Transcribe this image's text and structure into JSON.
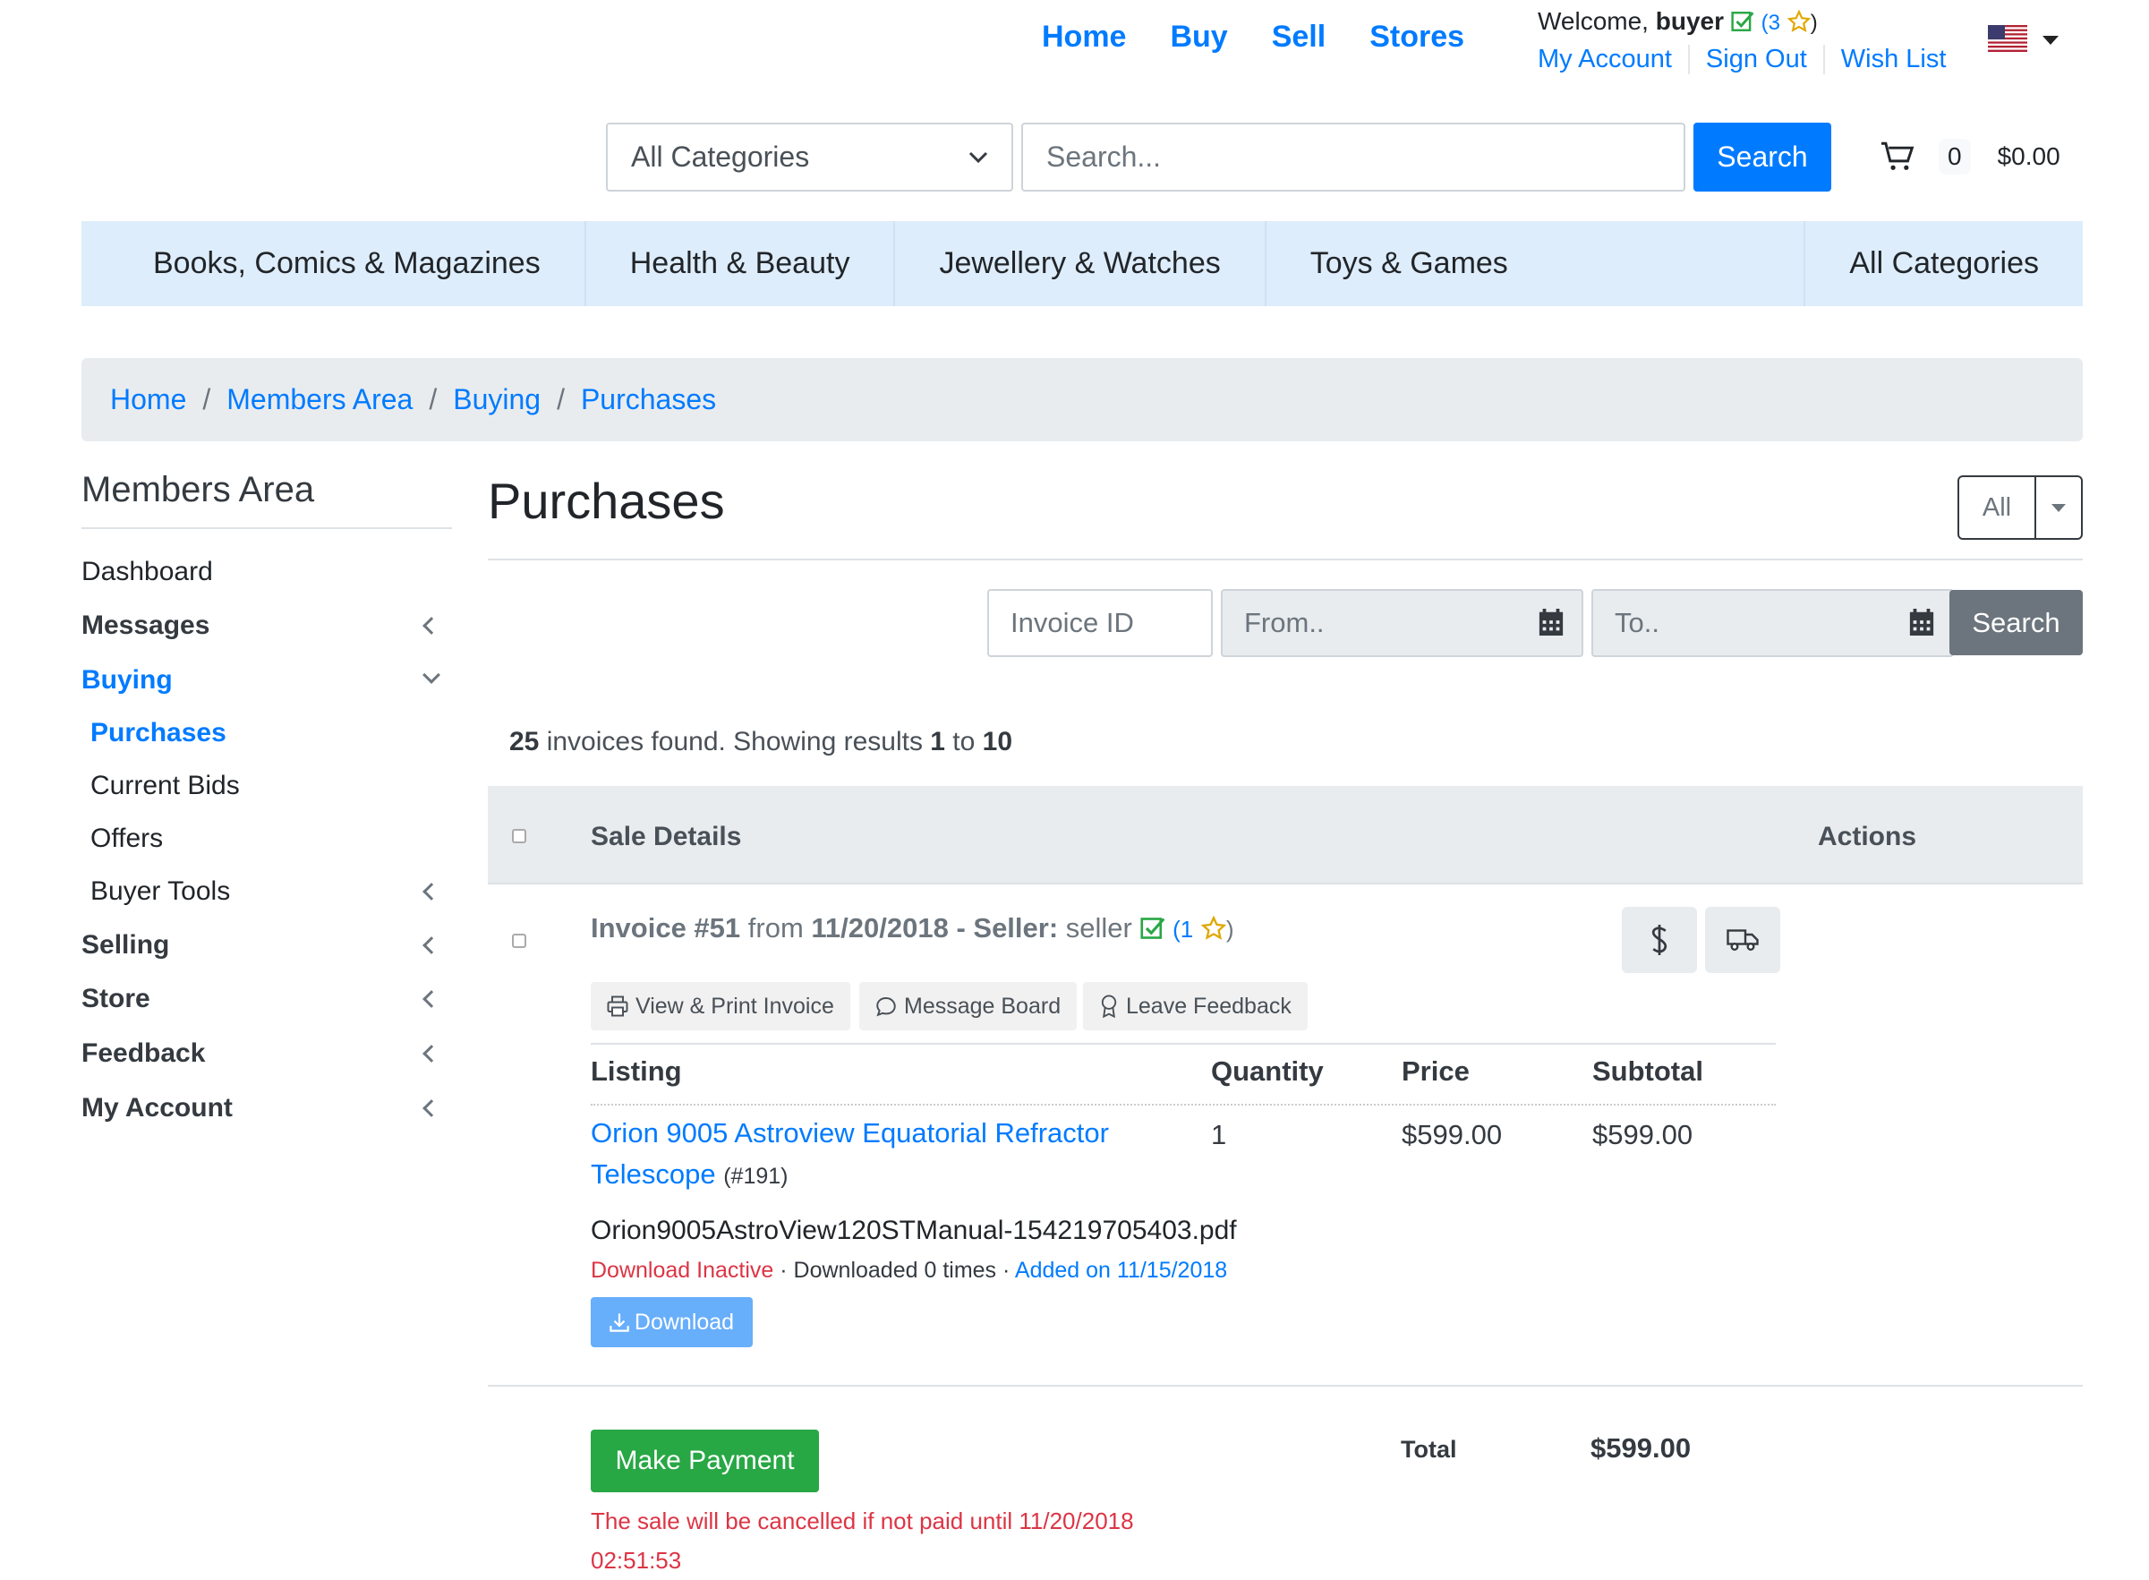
{
  "header": {
    "nav": [
      "Home",
      "Buy",
      "Sell",
      "Stores"
    ],
    "welcome_prefix": "Welcome,",
    "username": "buyer",
    "rating_open": "(",
    "rating": "3",
    "rating_close": ")",
    "account_links": [
      "My Account",
      "Sign Out",
      "Wish List"
    ]
  },
  "search": {
    "category": "All Categories",
    "placeholder": "Search...",
    "button": "Search"
  },
  "cart": {
    "count": "0",
    "total": "$0.00"
  },
  "categories": [
    "Books, Comics & Magazines",
    "Health & Beauty",
    "Jewellery & Watches",
    "Toys & Games",
    "All Categories"
  ],
  "breadcrumb": [
    "Home",
    "Members Area",
    "Buying",
    "Purchases"
  ],
  "sidebar": {
    "title": "Members Area",
    "items": [
      {
        "label": "Dashboard"
      },
      {
        "label": "Messages"
      },
      {
        "label": "Buying"
      },
      {
        "label": "Purchases"
      },
      {
        "label": "Current Bids"
      },
      {
        "label": "Offers"
      },
      {
        "label": "Buyer Tools"
      },
      {
        "label": "Selling"
      },
      {
        "label": "Store"
      },
      {
        "label": "Feedback"
      },
      {
        "label": "My Account"
      }
    ]
  },
  "main": {
    "title": "Purchases",
    "filter_dropdown": "All",
    "filters": {
      "invoice_placeholder": "Invoice ID",
      "from_placeholder": "From..",
      "to_placeholder": "To..",
      "search_button": "Search"
    },
    "results": {
      "total": "25",
      "text1": " invoices found. Showing results ",
      "from": "1",
      "text2": " to ",
      "to": "10"
    },
    "table_headers": {
      "details": "Sale Details",
      "actions": "Actions"
    }
  },
  "invoice": {
    "label": "Invoice #51",
    "from_word": " from ",
    "date": "11/20/2018",
    "seller_sep": " - Seller:",
    "seller": " seller",
    "seller_rating_open": "(",
    "seller_rating": "1",
    "seller_rating_close": ")",
    "buttons": [
      "View & Print Invoice",
      "Message Board",
      "Leave Feedback"
    ],
    "columns": [
      "Listing",
      "Quantity",
      "Price",
      "Subtotal"
    ],
    "item": {
      "title": "Orion 9005 Astroview Equatorial Refractor Telescope",
      "id": "(#191)",
      "quantity": "1",
      "price": "$599.00",
      "subtotal": "$599.00"
    },
    "download": {
      "filename": "Orion9005AstroView120STManual-154219705403.pdf",
      "status": "Download Inactive",
      "count_text": "Downloaded 0 times",
      "added": "Added on 11/15/2018",
      "button": "Download"
    },
    "pay_button": "Make Payment",
    "warning": "The sale will be cancelled if not paid until 11/20/2018 02:51:53",
    "total_label": "Total",
    "total": "$599.00"
  }
}
